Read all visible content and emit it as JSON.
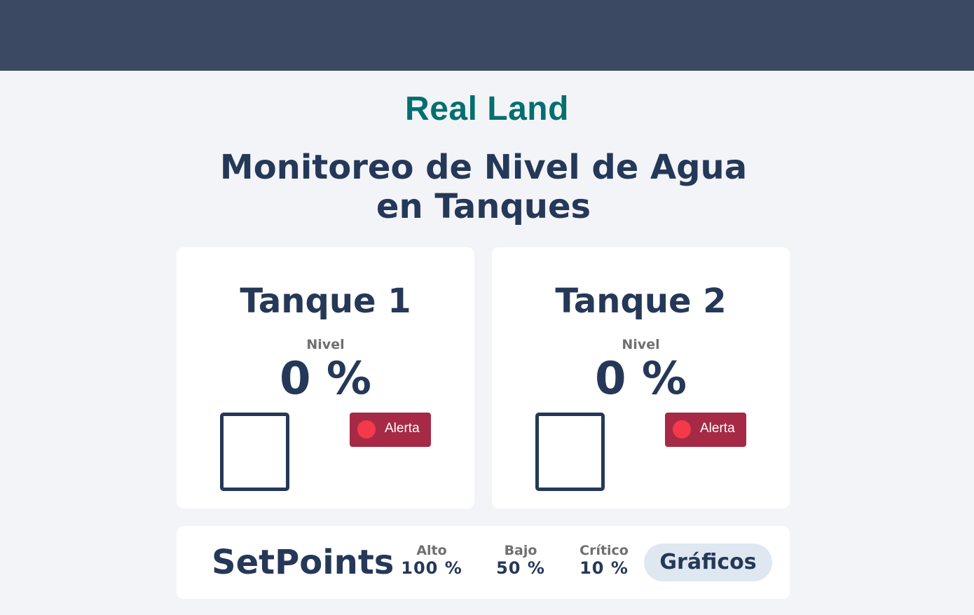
{
  "header": {
    "brand": "Real Land",
    "title": "Monitoreo de Nivel de Agua en Tanques"
  },
  "tanks": [
    {
      "name": "Tanque 1",
      "level_label": "Nivel",
      "level_value": "0 %",
      "level_fraction": 0,
      "alert_label": "Alerta"
    },
    {
      "name": "Tanque 2",
      "level_label": "Nivel",
      "level_value": "0 %",
      "level_fraction": 0,
      "alert_label": "Alerta"
    }
  ],
  "setpoints": {
    "title": "SetPoints",
    "items": [
      {
        "label": "Alto",
        "value": "100 %"
      },
      {
        "label": "Bajo",
        "value": "50 %"
      },
      {
        "label": "Crítico",
        "value": "10 %"
      }
    ],
    "graphs_label": "Gráficos"
  },
  "colors": {
    "topbar": "#3b4a62",
    "brand": "#046f6f",
    "text_primary": "#253858",
    "alert_bg": "#a62a45",
    "alert_dot": "#f43a4a",
    "graphs_button_bg": "#dfe7f1"
  }
}
